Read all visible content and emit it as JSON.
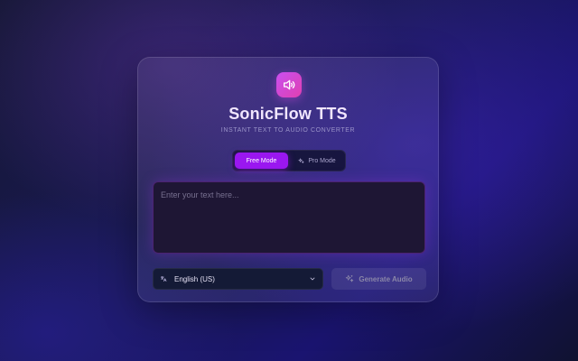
{
  "app": {
    "title": "SonicFlow TTS",
    "subtitle": "INSTANT TEXT TO AUDIO CONVERTER",
    "logo_icon": "speaker-icon"
  },
  "modes": {
    "free_label": "Free Mode",
    "pro_label": "Pro Mode",
    "pro_icon": "sparkle-icon",
    "selected": "Free Mode"
  },
  "input": {
    "placeholder": "Enter your text here...",
    "value": ""
  },
  "language": {
    "selected": "English (US)",
    "icon": "translate-icon"
  },
  "generate": {
    "label": "Generate Audio",
    "icon": "sparkle-icon"
  },
  "colors": {
    "accent": "#9a17f0",
    "logo_gradient_start": "#c94ff0",
    "logo_gradient_end": "#e040b0",
    "title": "#f1e6ff"
  }
}
